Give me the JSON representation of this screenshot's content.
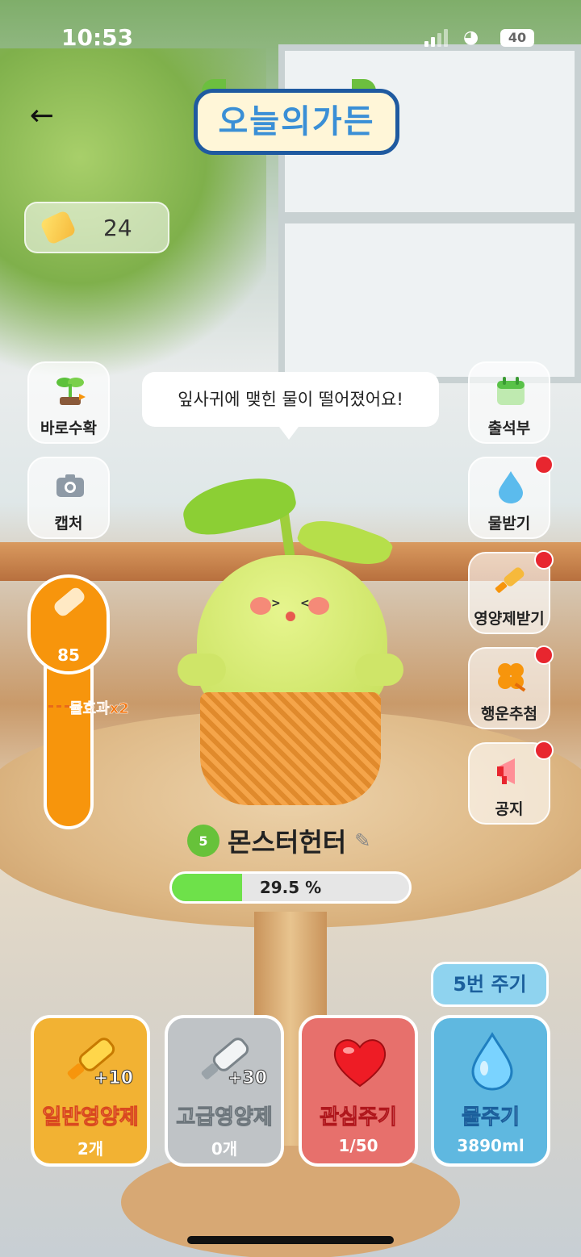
{
  "status_bar": {
    "time": "10:53",
    "battery": "40"
  },
  "header": {
    "title": "오늘의가든"
  },
  "tickets": {
    "count": "24"
  },
  "left_buttons": [
    {
      "label": "바로수확",
      "icon": "sprout-icon"
    },
    {
      "label": "캡처",
      "icon": "camera-icon"
    }
  ],
  "right_buttons": [
    {
      "label": "출석부",
      "icon": "calendar-icon",
      "badge": false
    },
    {
      "label": "물받기",
      "icon": "water-drop-icon",
      "badge": true
    },
    {
      "label": "영양제받기",
      "icon": "nutrient-bottle-icon",
      "badge": true
    },
    {
      "label": "행운추첨",
      "icon": "clover-icon",
      "badge": true
    },
    {
      "label": "공지",
      "icon": "megaphone-icon",
      "badge": true
    }
  ],
  "speech_bubble": "잎사귀에 맺힌 물이 떨어졌어요!",
  "water_meter": {
    "value": "85",
    "bonus_label": "물효과x2",
    "fill_fraction": 0.85
  },
  "plant": {
    "level": "5",
    "name": "몬스터헌터"
  },
  "growth": {
    "percent_text": "29.5 %",
    "percent": 29.5
  },
  "water_times": "5번 주기",
  "actions": [
    {
      "label": "일반영양제",
      "count": "2개",
      "bonus": "+10",
      "color": "#f2b233",
      "icon": "bottle-icon"
    },
    {
      "label": "고급영양제",
      "count": "0개",
      "bonus": "+30",
      "color": "#bfc3c6",
      "icon": "premium-bottle-icon"
    },
    {
      "label": "관심주기",
      "count": "1/50",
      "bonus": "",
      "color": "#e7706c",
      "icon": "heart-icon"
    },
    {
      "label": "물주기",
      "count": "3890ml",
      "bonus": "",
      "color": "#5fb8e0",
      "icon": "water-drop-icon"
    }
  ]
}
